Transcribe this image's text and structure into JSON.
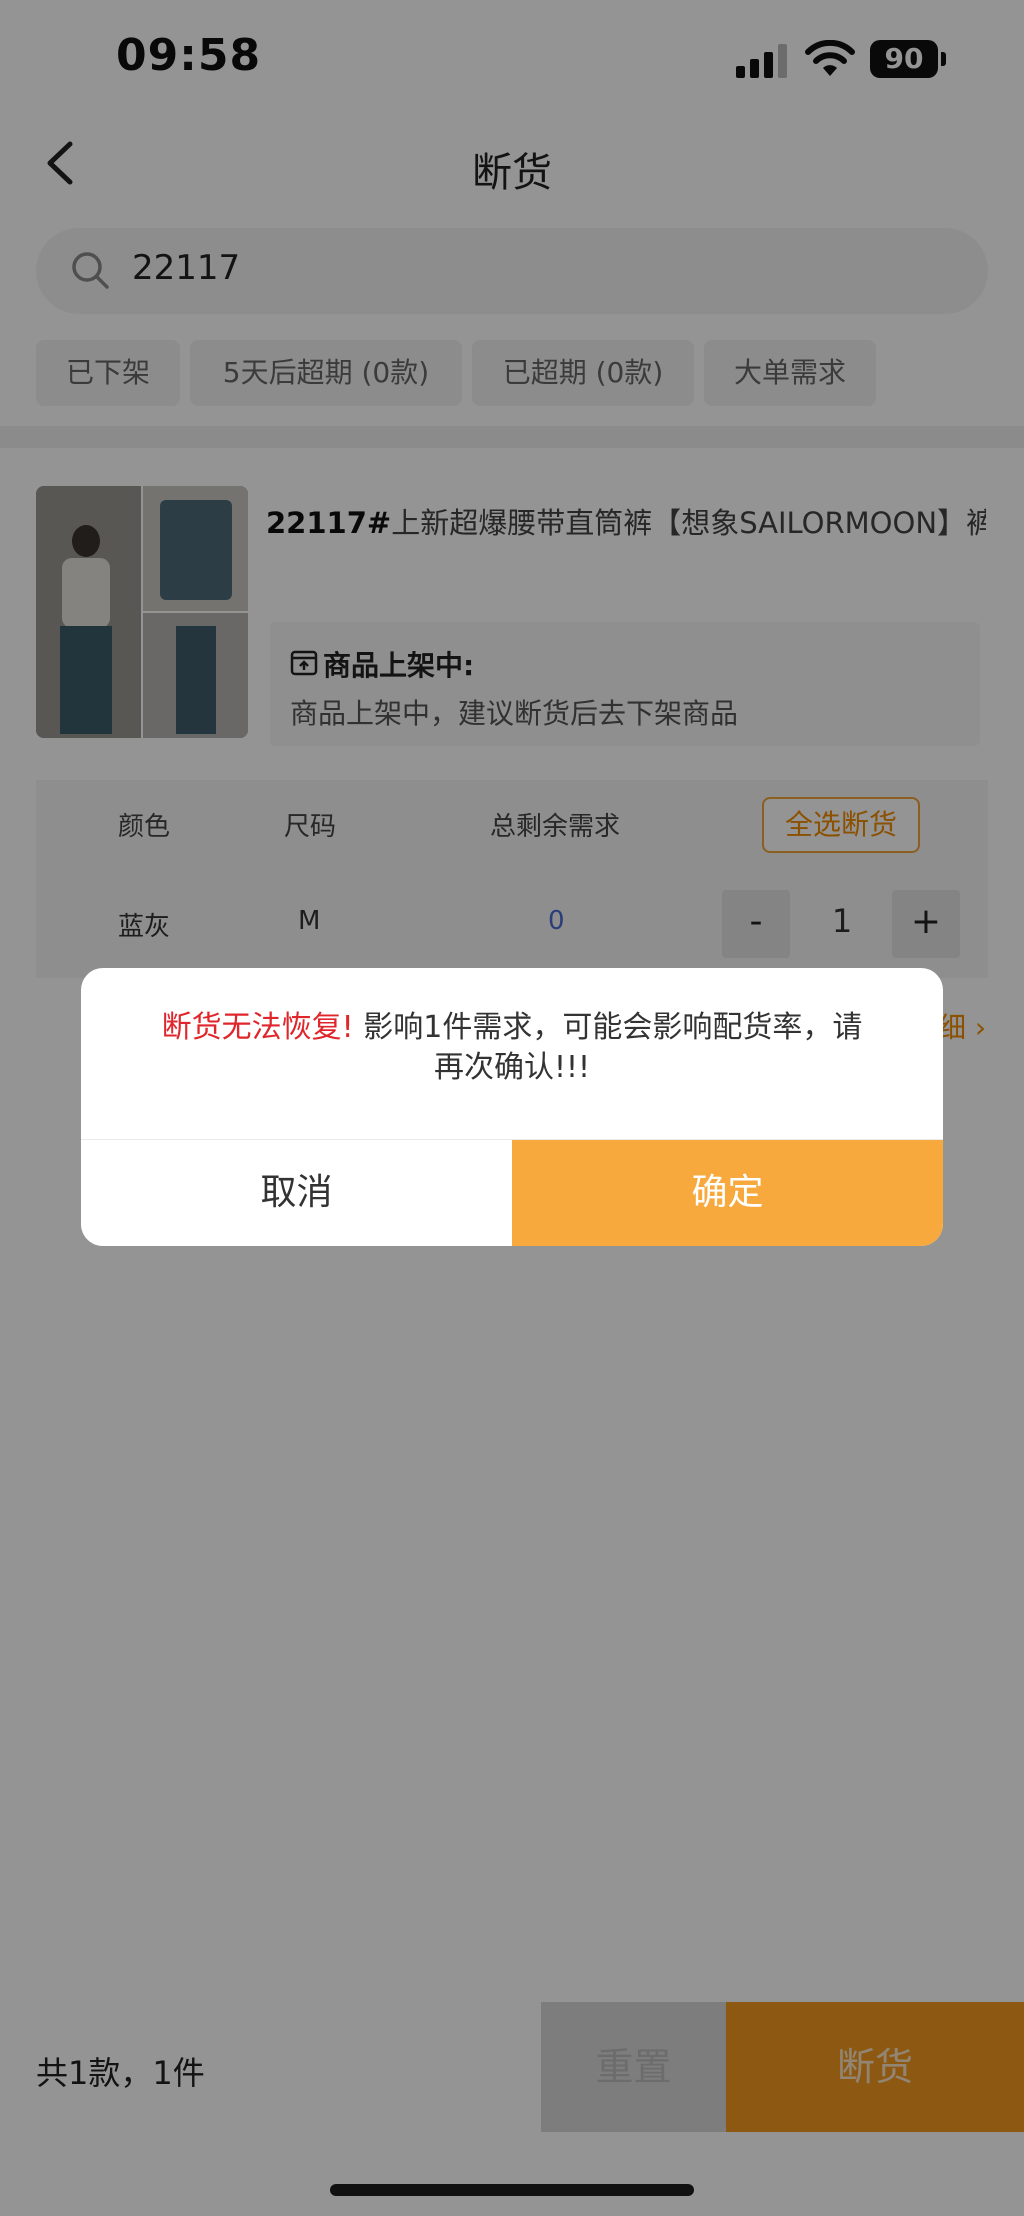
{
  "status_bar": {
    "time": "09:58",
    "battery": "90"
  },
  "nav": {
    "title": "断货"
  },
  "search": {
    "value": "22117"
  },
  "filters": [
    "已下架",
    "5天后超期 (0款)",
    "已超期 (0款)",
    "大单需求"
  ],
  "product": {
    "code": "22117#",
    "title_rest": "上新超爆腰带直筒裤【想象SAILORMOON】裤…",
    "notice_title": "商品上架中:",
    "notice_text": "商品上架中，建议断货后去下架商品"
  },
  "sku_table": {
    "headers": {
      "color": "颜色",
      "size": "尺码",
      "remaining": "总剩余需求"
    },
    "select_all_label": "全选断货",
    "rows": [
      {
        "color": "蓝灰",
        "size": "M",
        "remaining": "0",
        "quantity": "1"
      }
    ],
    "stepper": {
      "minus": "-",
      "plus": "+"
    },
    "detail_link": "细 ›"
  },
  "bottom_bar": {
    "total": "共1款，1件",
    "reset_label": "重置",
    "submit_label": "断货"
  },
  "dialog": {
    "warning": "断货无法恢复!",
    "message_line1": " 影响1件需求，可能会影响配货率，请",
    "message_line2": "再次确认!!!",
    "cancel_label": "取消",
    "confirm_label": "确定"
  },
  "colors": {
    "accent": "#f7a93e",
    "warning": "#e0262b",
    "link_blue": "#4a6bd2"
  }
}
